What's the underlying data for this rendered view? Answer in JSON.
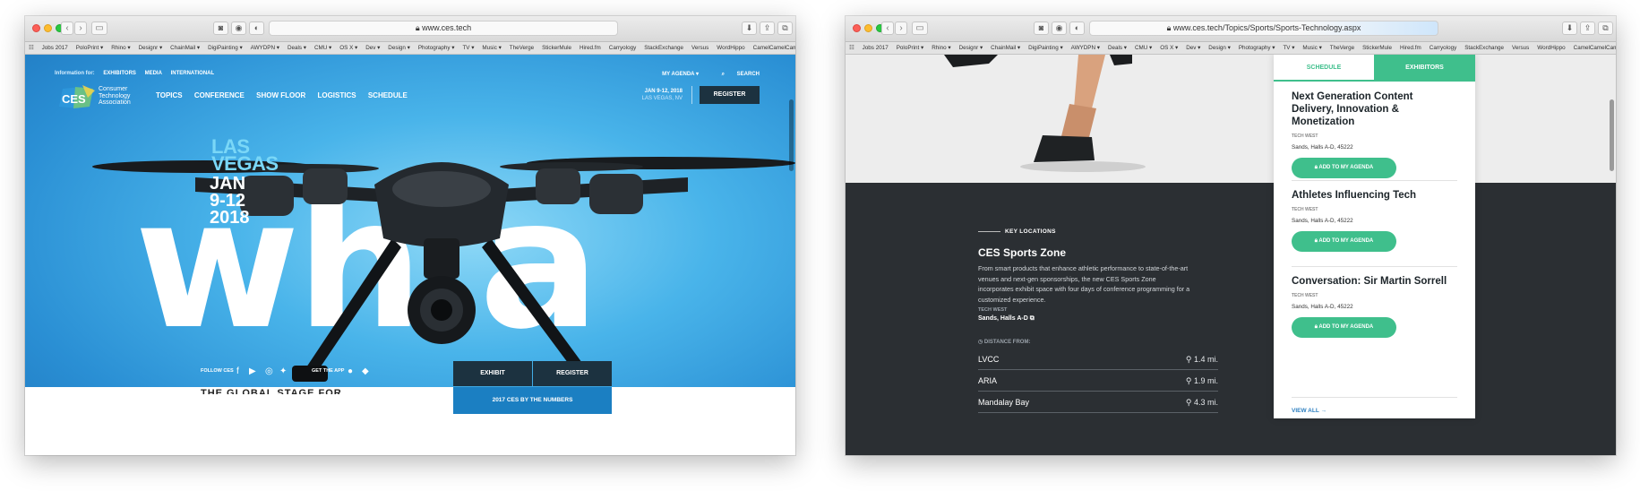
{
  "window1": {
    "url": "www.ces.tech",
    "bookmarks": [
      "Jobs 2017",
      "PoloPrint ▾",
      "Rhino ▾",
      "Designr ▾",
      "ChainMail ▾",
      "DigiPainting ▾",
      "AWYDPN ▾",
      "Deals ▾",
      "CMU ▾",
      "OS X ▾",
      "Dev ▾",
      "Design ▾",
      "Photography ▾",
      "TV ▾",
      "Music ▾",
      "TheVerge",
      "StickerMule",
      "Hired.fm",
      "Carryology",
      "StackExchange",
      "Versus",
      "WordHippo",
      "CamelCamelCamel",
      ">>"
    ],
    "info_label": "Information for:",
    "info_links": [
      "EXHIBITORS",
      "MEDIA",
      "INTERNATIONAL"
    ],
    "my_agenda": "MY AGENDA ▾",
    "search": "SEARCH",
    "logo_text": "CES",
    "logo_sub": [
      "Consumer",
      "Technology",
      "Association"
    ],
    "nav": [
      "TOPICS",
      "CONFERENCE",
      "SHOW FLOOR",
      "LOGISTICS",
      "SCHEDULE"
    ],
    "date": "JAN 9-12, 2018",
    "location": "LAS VEGAS, NV",
    "register": "REGISTER",
    "hero_city": [
      "LAS",
      "VEGAS"
    ],
    "hero_dates": [
      "JAN",
      "9-12",
      "2018"
    ],
    "hero_word": "wh a",
    "follow": "FOLLOW CES",
    "get_app": "GET THE APP",
    "exhibit": "EXHIBIT",
    "register2": "REGISTER",
    "by_numbers": "2017 CES BY THE NUMBERS",
    "peek_heading": "THE GLOBAL STAGE FOR"
  },
  "window2": {
    "url": "www.ces.tech/Topics/Sports/Sports-Technology.aspx",
    "bookmarks": [
      "Jobs 2017",
      "PoloPrint ▾",
      "Rhino ▾",
      "Designr ▾",
      "ChainMail ▾",
      "DigiPainting ▾",
      "AWYDPN ▾",
      "Deals ▾",
      "CMU ▾",
      "OS X ▾",
      "Dev ▾",
      "Design ▾",
      "Photography ▾",
      "TV ▾",
      "Music ▾",
      "TheVerge",
      "StickerMule",
      "Hired.fm",
      "Carryology",
      "StackExchange",
      "Versus",
      "WordHippo",
      "CamelCamelCamel",
      ">>"
    ],
    "key_locations": "KEY LOCATIONS",
    "zone_title": "CES Sports Zone",
    "zone_desc": "From smart products that enhance athletic performance to state-of-the-art venues and next-gen sponsorships, the new CES Sports Zone incorporates exhibit space with four days of conference programming for a customized experience.",
    "zone_cat": "TECH WEST",
    "zone_loc": "Sands, Halls A-D",
    "distance_from": "DISTANCE FROM:",
    "distances": [
      {
        "name": "LVCC",
        "value": "1.4 mi."
      },
      {
        "name": "ARIA",
        "value": "1.9 mi."
      },
      {
        "name": "Mandalay Bay",
        "value": "4.3 mi."
      }
    ],
    "tab_schedule": "SCHEDULE",
    "tab_exhibitors": "EXHIBITORS",
    "sessions": [
      {
        "title": "Next Generation Content Delivery, Innovation & Monetization",
        "cat": "TECH WEST",
        "loc": "Sands, Halls A-D, 45222",
        "btn": "ADD TO MY AGENDA"
      },
      {
        "title": "Athletes Influencing Tech",
        "cat": "TECH WEST",
        "loc": "Sands, Halls A-D, 45222",
        "btn": "ADD TO MY AGENDA"
      },
      {
        "title": "Conversation: Sir Martin Sorrell",
        "cat": "TECH WEST",
        "loc": "Sands, Halls A-D, 45222",
        "btn": "ADD TO MY AGENDA"
      }
    ],
    "view_all": "VIEW ALL →"
  }
}
